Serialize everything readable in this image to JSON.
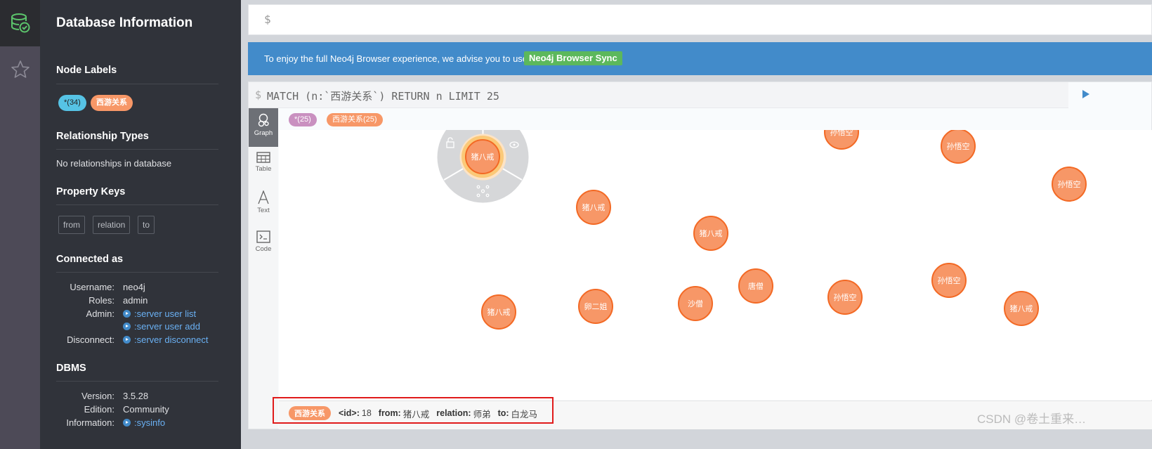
{
  "sidebar": {
    "icons": [
      "database-icon",
      "star-icon"
    ]
  },
  "drawer": {
    "title": "Database Information",
    "node_labels": {
      "heading": "Node Labels",
      "all_label": "*(34)",
      "category_label": "西游关系"
    },
    "relationship_types": {
      "heading": "Relationship Types",
      "empty_text": "No relationships in database"
    },
    "property_keys": {
      "heading": "Property Keys",
      "keys": [
        "from",
        "relation",
        "to"
      ]
    },
    "connected_as": {
      "heading": "Connected as",
      "username_label": "Username:",
      "username": "neo4j",
      "roles_label": "Roles:",
      "roles": "admin",
      "admin_label": "Admin:",
      "admin_links": [
        ":server user list",
        ":server user add"
      ],
      "disconnect_label": "Disconnect:",
      "disconnect_link": ":server disconnect"
    },
    "dbms": {
      "heading": "DBMS",
      "version_label": "Version:",
      "version": "3.5.28",
      "edition_label": "Edition:",
      "edition": "Community",
      "information_label": "Information:",
      "information_link": ":sysinfo"
    }
  },
  "editor": {
    "prompt": "$"
  },
  "banner": {
    "text": "To enjoy the full Neo4j Browser experience, we advise you to use",
    "button_label": "Neo4j Browser Sync"
  },
  "result_frame": {
    "prompt": "$",
    "query": "MATCH (n:`西游关系`) RETURN n LIMIT 25",
    "tabs": [
      {
        "label": "Graph",
        "icon": "graph-icon"
      },
      {
        "label": "Table",
        "icon": "table-icon"
      },
      {
        "label": "Text",
        "icon": "text-icon"
      },
      {
        "label": "Code",
        "icon": "code-icon"
      }
    ],
    "graph_labels": {
      "all": "*(25)",
      "category": "西游关系(25)"
    },
    "nodes": [
      "猪八戒",
      "猪八戒",
      "猪八戒",
      "猪八戒",
      "孙悟空",
      "孙悟空",
      "孙悟空",
      "孙悟空",
      "孙悟空",
      "卵二姐",
      "沙僧",
      "唐僧"
    ],
    "selected_node": "猪八戒",
    "node_color": "#f79767",
    "properties": {
      "label": "西游关系",
      "id_key": "<id>:",
      "id_value": "18",
      "from_key": "from:",
      "from_value": "猪八戒",
      "relation_key": "relation:",
      "relation_value": "师弟",
      "to_key": "to:",
      "to_value": "白龙马"
    }
  },
  "watermark": "CSDN @卷土重来…",
  "colors": {
    "banner": "#428bca",
    "sync_button": "#5cb85c",
    "accent_label": "#f79767",
    "all_label": "#56c3e5",
    "highlight": "#e01b1b"
  }
}
